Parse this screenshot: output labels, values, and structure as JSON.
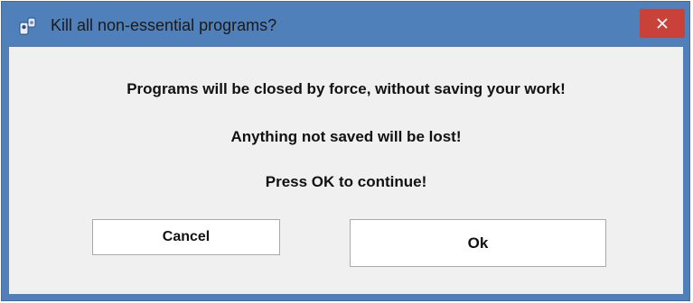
{
  "window": {
    "title": "Kill all non-essential programs?",
    "icon": "app-icon",
    "close_icon": "close-icon"
  },
  "dialog": {
    "message_line_1": "Programs will be closed by force, without saving your work!",
    "message_line_2": "Anything not saved will be lost!",
    "message_line_3": "Press OK to continue!"
  },
  "buttons": {
    "cancel_label": "Cancel",
    "ok_label": "Ok"
  },
  "colors": {
    "title_bar": "#4f80b9",
    "close_button": "#c9423a",
    "dialog_background": "#f0f0f0"
  }
}
